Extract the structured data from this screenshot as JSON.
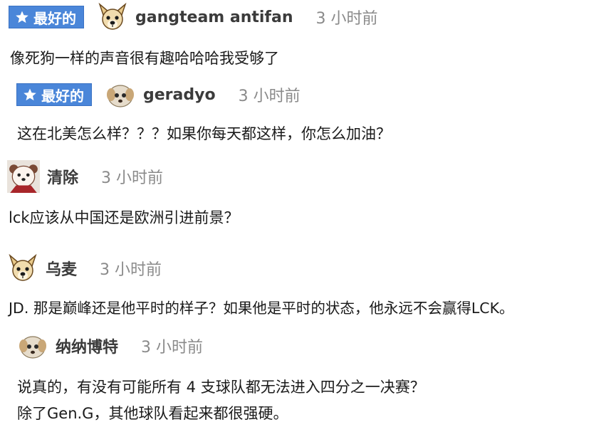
{
  "comments": [
    {
      "badge": "最好的",
      "username": "gangteam antifan",
      "time": "3 小时前",
      "text": [
        "像死狗一样的声音很有趣哈哈哈我受够了"
      ],
      "avatar": "dog-avatar"
    },
    {
      "badge": "最好的",
      "username": "geradyo",
      "time": "3 小时前",
      "text": [
        "这在北美怎么样？？？如果你每天都这样，你怎么加油？"
      ],
      "avatar": "puppy-avatar"
    },
    {
      "username": "清除",
      "time": "3 小时前",
      "text": [
        "lck应该从中国还是欧洲引进前景？"
      ],
      "avatar": "bear-avatar"
    },
    {
      "username": "乌麦",
      "time": "3 小时前",
      "text": [
        "JD. 那是巅峰还是他平时的样子？如果他是平时的状态，他永远不会赢得LCK。"
      ],
      "avatar": "dog-avatar"
    },
    {
      "username": "纳纳博特",
      "time": "3 小时前",
      "text": [
        "说真的，有没有可能所有 4 支球队都无法进入四分之一决赛？",
        "除了Gen.G，其他球队看起来都很强硬。"
      ],
      "avatar": "puppy-avatar"
    }
  ],
  "colors": {
    "badge_bg": "#4a86d9",
    "username": "#3b3b3b",
    "time": "#8a8a8a"
  }
}
